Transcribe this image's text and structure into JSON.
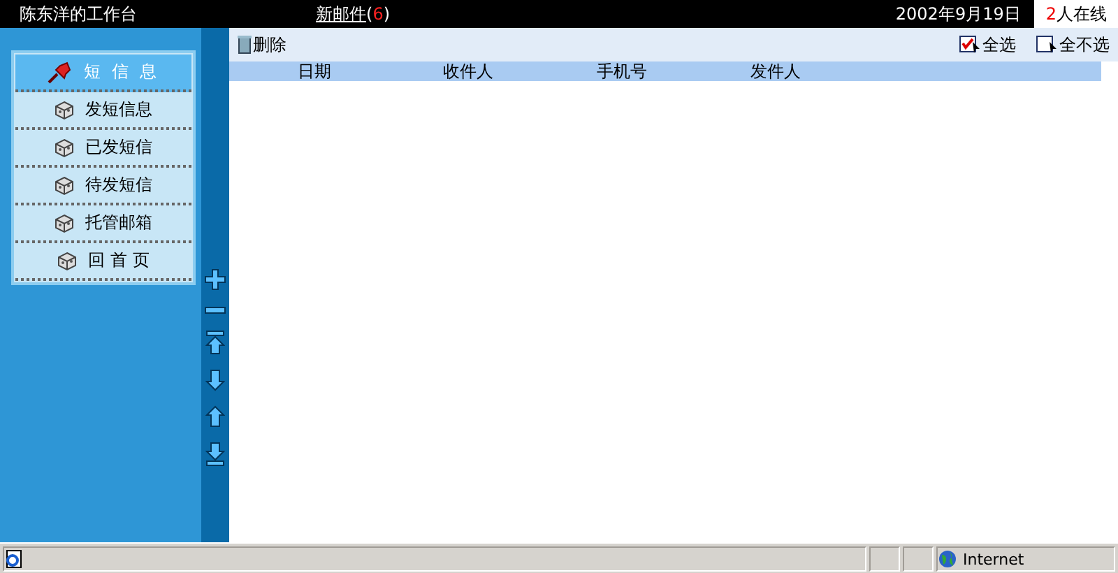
{
  "header": {
    "title": "陈东洋的工作台",
    "mail_link": "新邮件",
    "mail_count_open": "(",
    "mail_count": "6",
    "mail_count_close": ")",
    "date": "2002年9月19日",
    "online_count": "2",
    "online_label": "人在线"
  },
  "sidebar": {
    "items": [
      {
        "label": "短 信 息",
        "kind": "heading",
        "selected": true
      },
      {
        "label": "发短信息",
        "kind": "link",
        "selected": false
      },
      {
        "label": "已发短信",
        "kind": "link",
        "selected": false
      },
      {
        "label": "待发短信",
        "kind": "link",
        "selected": false
      },
      {
        "label": "托管邮箱",
        "kind": "link",
        "selected": false
      },
      {
        "label": "回 首 页",
        "kind": "link",
        "selected": false
      }
    ]
  },
  "toolbar": {
    "delete": "删除",
    "select_all": "全选",
    "select_none": "全不选"
  },
  "table": {
    "columns": [
      "日期",
      "收件人",
      "手机号",
      "发件人"
    ]
  },
  "status_bar": {
    "zone": "Internet"
  }
}
